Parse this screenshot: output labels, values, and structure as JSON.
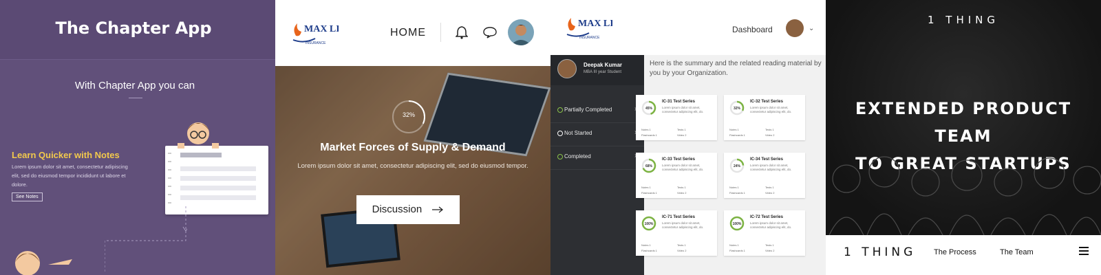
{
  "panel1": {
    "title": "The Chapter App",
    "subtitle": "With Chapter App you can",
    "feature_title": "Learn Quicker with Notes",
    "feature_desc": "Lorem ipsum dolor sit amet, consectetur adipiscing elit, sed do eiusmod tempor incididunt ut labore et dolore.",
    "see_notes_label": "See Notes",
    "bg_color": "#61507a",
    "accent_color": "#f2c94c"
  },
  "panel2": {
    "logo_text": "MAX LIFE",
    "logo_sub": "INSURANCE",
    "home_label": "HOME",
    "progress_label": "32%",
    "progress_value": 0.32,
    "hero_title": "Market Forces of Supply & Demand",
    "hero_desc": "Lorem ipsum dolor sit amet, consectetur adipiscing elit, sed do eiusmod tempor.",
    "discussion_label": "Discussion",
    "icons": [
      "bell-icon",
      "chat-icon",
      "arrow-right-icon"
    ]
  },
  "panel3": {
    "logo_text": "MAX LIFE",
    "logo_sub": "INSURANCE",
    "dashboard_label": "Dashboard",
    "user_name": "Deepak Kumar",
    "user_role": "MBA III year Student",
    "intro": "Here is the summary and the related reading material by you by your Organization.",
    "sidebar_items": [
      {
        "label": "Partially Completed",
        "color": "#8bc34a"
      },
      {
        "label": "Not Started",
        "color": "#ffffff"
      },
      {
        "label": "Completed",
        "color": "#8bc34a"
      }
    ],
    "cards": [
      {
        "title": "IC-31 Test Series",
        "pct": "45%",
        "value": 0.45,
        "desc": "Lorem ipsum dolor sit amet, consectetur adipiscing elit, do.",
        "notes": "Notes 1",
        "tests": "Tests 1",
        "flashcards": "Flashcards 1",
        "video": "Video 2"
      },
      {
        "title": "IC-32 Test Series",
        "pct": "32%",
        "value": 0.32,
        "desc": "Lorem ipsum dolor sit amet, consectetur adipiscing elit, do.",
        "notes": "Notes 1",
        "tests": "Tests 1",
        "flashcards": "Flashcards 1",
        "video": "Video 2"
      },
      {
        "title": "IC-33 Test Series",
        "pct": "68%",
        "value": 0.68,
        "desc": "Lorem ipsum dolor sit amet, consectetur adipiscing elit, do.",
        "notes": "Notes 1",
        "tests": "Tests 1",
        "flashcards": "Flashcards 1",
        "video": "Video 2"
      },
      {
        "title": "IC-34 Test Series",
        "pct": "24%",
        "value": 0.24,
        "desc": "Lorem ipsum dolor sit amet, consectetur adipiscing elit, do.",
        "notes": "Notes 1",
        "tests": "Tests 1",
        "flashcards": "Flashcards 1",
        "video": "Video 2"
      },
      {
        "title": "IC-71 Test Series",
        "pct": "100%",
        "value": 1.0,
        "desc": "Lorem ipsum dolor sit amet, consectetur adipiscing elit, do.",
        "notes": "Notes 1",
        "tests": "Tests 1",
        "flashcards": "Flashcards 1",
        "video": "Video 2"
      },
      {
        "title": "IC-72 Test Series",
        "pct": "100%",
        "value": 1.0,
        "desc": "Lorem ipsum dolor sit amet, consectetur adipiscing elit, do.",
        "notes": "Notes 1",
        "tests": "Tests 1",
        "flashcards": "Flashcards 1",
        "video": "Video 2"
      }
    ],
    "ring_color": "#7cb342"
  },
  "panel4": {
    "brand_top": "1 THING",
    "headline_1": "EXTENDED PRODUCT TEAM",
    "headline_2": "TO GREAT STARTUPS",
    "nav_brand": "1 THING",
    "nav_links": [
      "The Process",
      "The Team"
    ],
    "icons": [
      "menu-icon"
    ]
  }
}
